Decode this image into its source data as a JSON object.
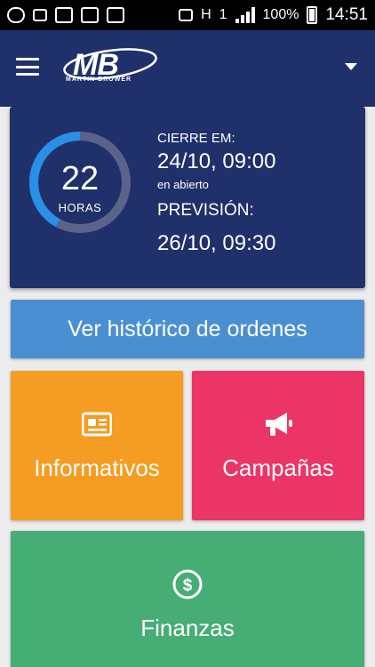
{
  "status_bar": {
    "battery_percent": "100%",
    "time": "14:51",
    "network_letter": "H",
    "sim_number": "1"
  },
  "app_bar": {
    "logo_mark": "MB",
    "logo_subtitle": "MARTIN BROWER"
  },
  "countdown": {
    "remaining_value": 22,
    "remaining_unit": "HORAS",
    "ring_fraction": 0.42,
    "close_label": "CIERRE EM:",
    "close_value": "24/10, 09:00",
    "close_status": "en abierto",
    "forecast_label": "PREVISIÓN:",
    "forecast_value": "26/10, 09:30"
  },
  "actions": {
    "history_label": "Ver histórico de ordenes"
  },
  "tiles": {
    "informativos": {
      "label": "Informativos",
      "icon": "newspaper-icon"
    },
    "campanas": {
      "label": "Campañas",
      "icon": "megaphone-icon"
    },
    "finanzas": {
      "label": "Finanzas",
      "icon": "dollar-circle-icon"
    }
  },
  "colors": {
    "primary": "#20306a",
    "history": "#4b8fd3",
    "informativos": "#f59c23",
    "campanas": "#eb3566",
    "finanzas": "#46ad75",
    "ring_progress": "#2a8fe6",
    "ring_track": "#5a6488"
  }
}
